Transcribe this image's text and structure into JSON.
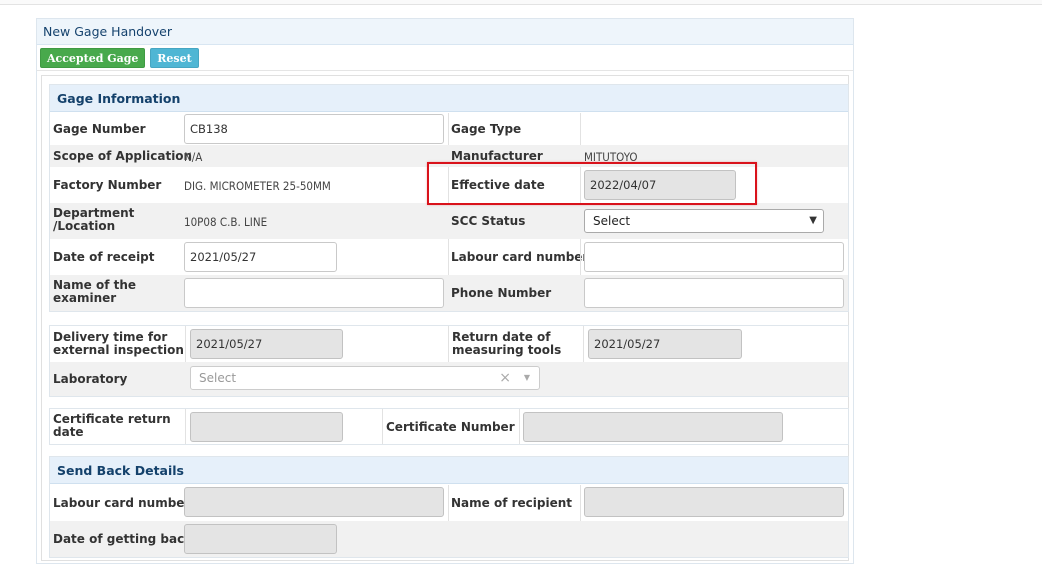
{
  "header": {
    "title": "New Gage Handover"
  },
  "toolbar": {
    "accepted_label": "Accepted Gage",
    "reset_label": "Reset"
  },
  "gage_info": {
    "title": "Gage Information",
    "gage_number_label": "Gage Number",
    "gage_number_value": "CB138",
    "gage_type_label": "Gage Type",
    "gage_type_value": "",
    "scope_label": "Scope of Application",
    "scope_value": "N/A",
    "manufacturer_label": "Manufacturer",
    "manufacturer_value": "MITUTOYO",
    "factory_number_label": "Factory Number",
    "factory_number_value": "DIG. MICROMETER 25-50MM",
    "effective_date_label": "Effective date",
    "effective_date_value": "2022/04/07",
    "department_label_1": "Department",
    "department_label_2": "/Location",
    "department_value": "10P08 C.B. LINE",
    "scc_status_label": "SCC Status",
    "scc_status_selected": "Select",
    "date_receipt_label": "Date of receipt",
    "date_receipt_value": "2021/05/27",
    "labour_card_label": "Labour card number",
    "labour_card_value": "",
    "examiner_label_1": "Name of the",
    "examiner_label_2": "examiner",
    "examiner_value": "",
    "phone_label": "Phone Number",
    "phone_value": ""
  },
  "inspection": {
    "delivery_label_1": "Delivery time for",
    "delivery_label_2": "external inspection",
    "delivery_value": "2021/05/27",
    "return_label_1": "Return date of",
    "return_label_2": "measuring tools",
    "return_value": "2021/05/27",
    "laboratory_label": "Laboratory",
    "laboratory_placeholder": "Select",
    "clear_symbol": "×"
  },
  "certificate": {
    "return_label_1": "Certificate return",
    "return_label_2": "date",
    "return_value": "",
    "number_label": "Certificate Number",
    "number_value": ""
  },
  "send_back": {
    "title": "Send Back Details",
    "labour_card_label": "Labour card number",
    "labour_card_value": "",
    "recipient_label": "Name of recipient",
    "recipient_value": "",
    "date_back_label": "Date of getting back",
    "date_back_value": ""
  },
  "colors": {
    "accent_green": "#48a94c",
    "accent_teal": "#4fb6d4",
    "highlight_red": "#d9121b",
    "section_header_bg": "#e6f0fa"
  },
  "icons": {
    "dropdown": "chevron-down-icon",
    "clear": "clear-icon"
  }
}
